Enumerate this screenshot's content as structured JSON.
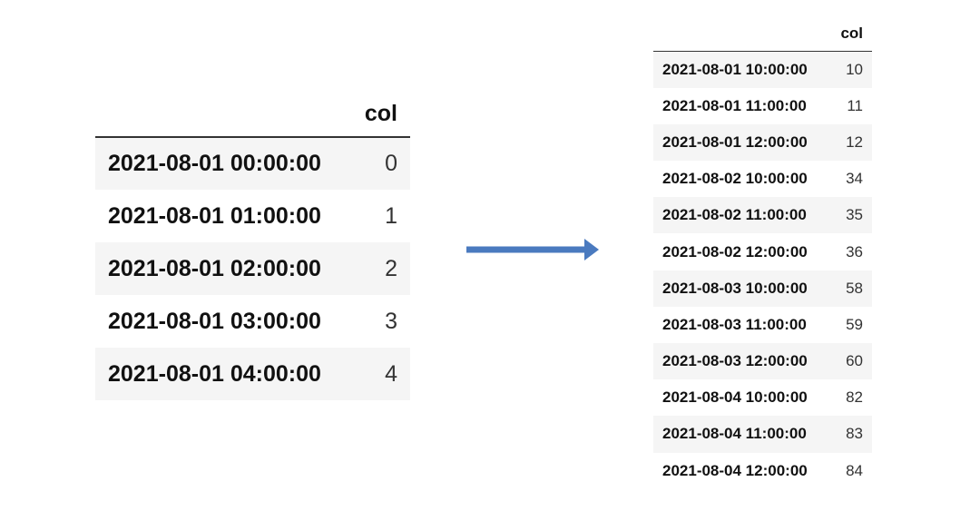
{
  "left_table": {
    "column_header": "col",
    "rows": [
      {
        "index": "2021-08-01 00:00:00",
        "value": "0"
      },
      {
        "index": "2021-08-01 01:00:00",
        "value": "1"
      },
      {
        "index": "2021-08-01 02:00:00",
        "value": "2"
      },
      {
        "index": "2021-08-01 03:00:00",
        "value": "3"
      },
      {
        "index": "2021-08-01 04:00:00",
        "value": "4"
      }
    ]
  },
  "right_table": {
    "column_header": "col",
    "rows": [
      {
        "index": "2021-08-01 10:00:00",
        "value": "10"
      },
      {
        "index": "2021-08-01 11:00:00",
        "value": "11"
      },
      {
        "index": "2021-08-01 12:00:00",
        "value": "12"
      },
      {
        "index": "2021-08-02 10:00:00",
        "value": "34"
      },
      {
        "index": "2021-08-02 11:00:00",
        "value": "35"
      },
      {
        "index": "2021-08-02 12:00:00",
        "value": "36"
      },
      {
        "index": "2021-08-03 10:00:00",
        "value": "58"
      },
      {
        "index": "2021-08-03 11:00:00",
        "value": "59"
      },
      {
        "index": "2021-08-03 12:00:00",
        "value": "60"
      },
      {
        "index": "2021-08-04 10:00:00",
        "value": "82"
      },
      {
        "index": "2021-08-04 11:00:00",
        "value": "83"
      },
      {
        "index": "2021-08-04 12:00:00",
        "value": "84"
      }
    ]
  },
  "arrow": {
    "icon": "right-arrow-icon",
    "color": "#4a7abf"
  }
}
